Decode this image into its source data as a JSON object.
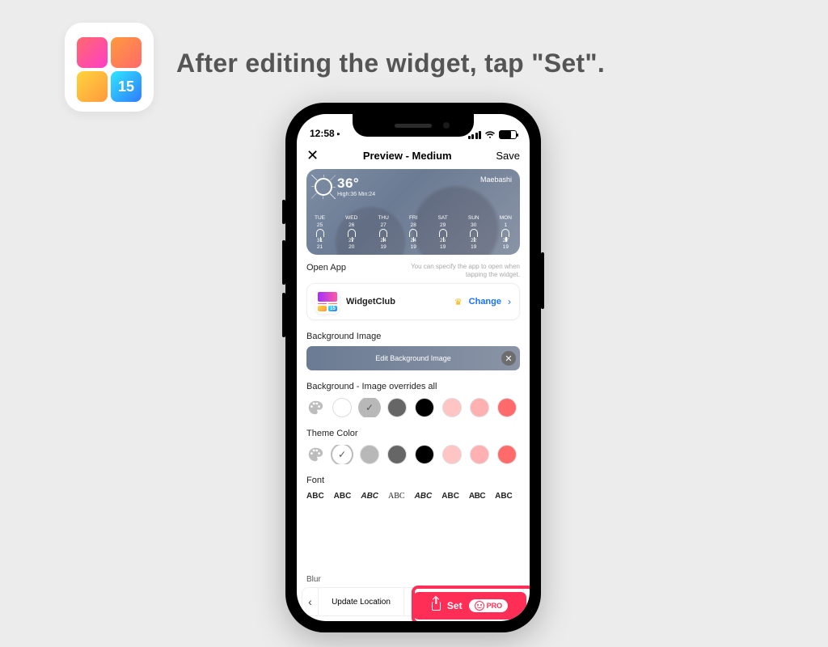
{
  "instruction": "After editing the widget, tap \"Set\".",
  "app_icon_badge": "15",
  "status": {
    "time": "12:58"
  },
  "nav": {
    "title": "Preview - Medium",
    "save": "Save"
  },
  "weather": {
    "temp": "36°",
    "high_low": "High:36 Min:24",
    "location": "Maebashi",
    "days": [
      {
        "d": "TUE",
        "dt": "25",
        "hi": "31",
        "lo": "21"
      },
      {
        "d": "WED",
        "dt": "26",
        "hi": "27",
        "lo": "20"
      },
      {
        "d": "THU",
        "dt": "27",
        "hi": "24",
        "lo": "19"
      },
      {
        "d": "FRI",
        "dt": "28",
        "hi": "24",
        "lo": "19"
      },
      {
        "d": "SAT",
        "dt": "29",
        "hi": "25",
        "lo": "19"
      },
      {
        "d": "SUN",
        "dt": "30",
        "hi": "22",
        "lo": "19"
      },
      {
        "d": "MON",
        "dt": "1",
        "hi": "27",
        "lo": "19"
      }
    ]
  },
  "open_app": {
    "label": "Open App",
    "help": "You can specify the app to open when tapping the widget.",
    "name": "WidgetClub",
    "change": "Change"
  },
  "bg_image": {
    "label": "Background Image",
    "edit_btn": "Edit Background Image"
  },
  "bg_color": {
    "label": "Background - Image overrides all",
    "swatches": [
      "#ffffff",
      "#b8b8b8",
      "#666666",
      "#000000",
      "#ffc4c4",
      "#ffb0b0",
      "#ff6a6a"
    ],
    "selected_index": 1
  },
  "theme": {
    "label": "Theme Color",
    "swatches": [
      "#ffffff",
      "#b8b8b8",
      "#666666",
      "#000000",
      "#ffc4c4",
      "#ffb0b0",
      "#ff6a6a"
    ],
    "selected_index": 0
  },
  "font": {
    "label": "Font",
    "sample": "ABC"
  },
  "actions": {
    "update_location": "Update Location",
    "set": "Set",
    "pro": "PRO",
    "blur": "Blur"
  }
}
